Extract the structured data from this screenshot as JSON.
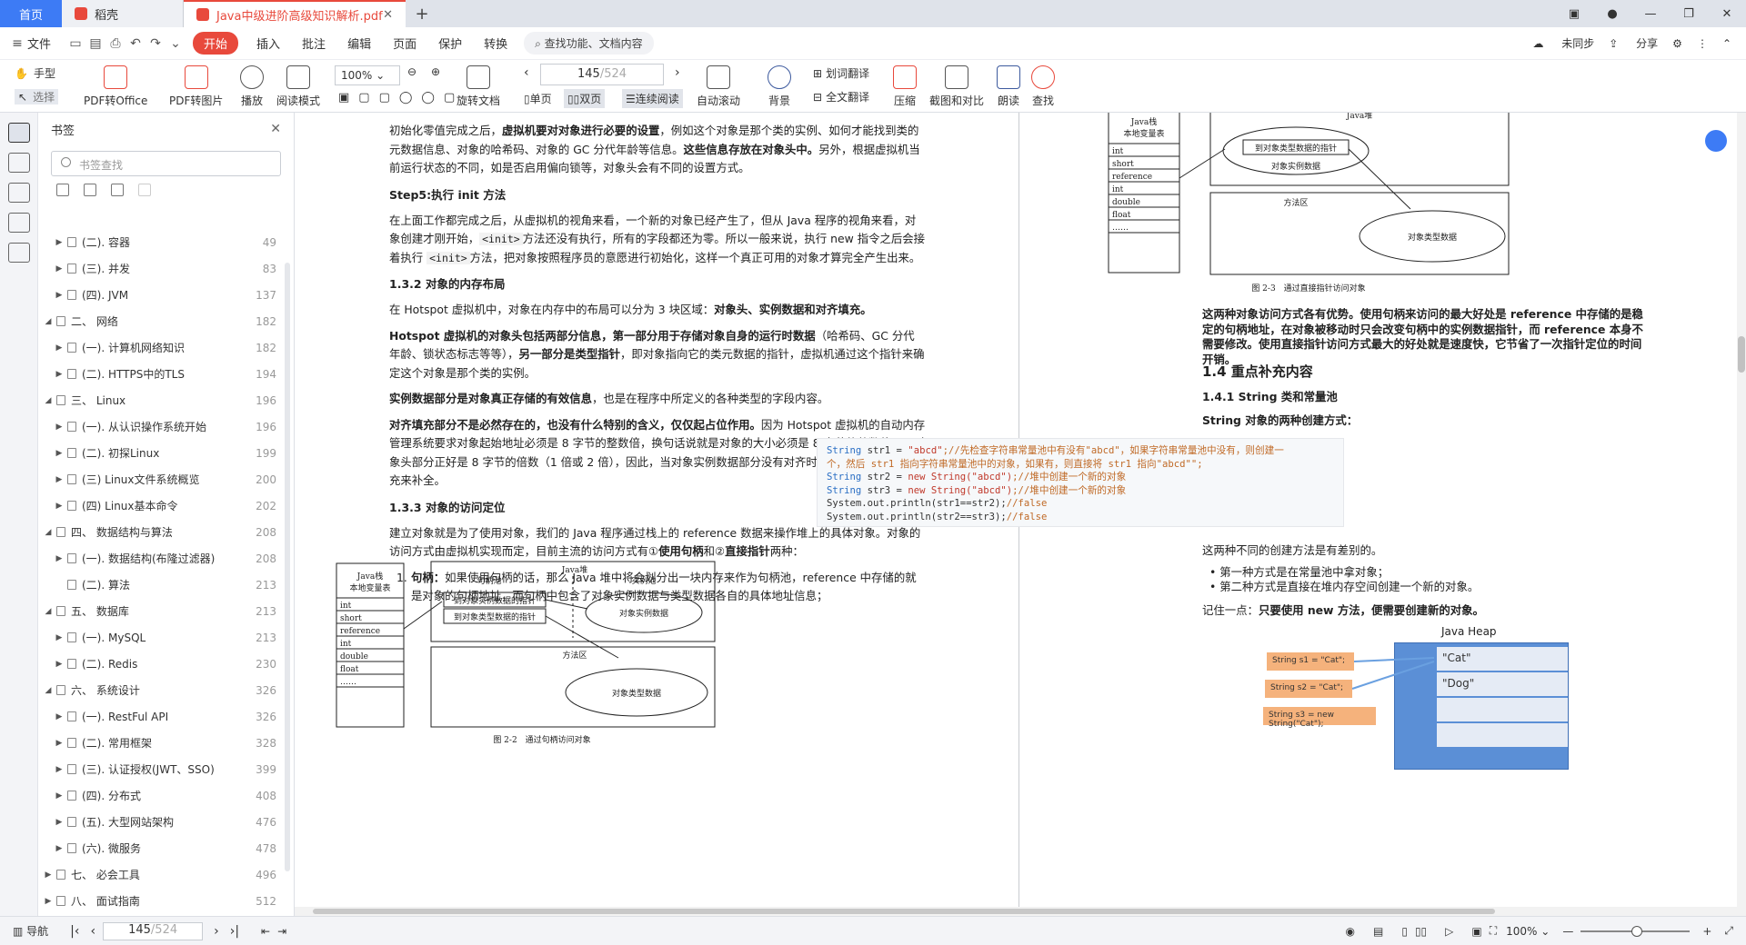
{
  "tabs": {
    "home": "首页",
    "store": "稻壳",
    "doc": "Java中级进阶高级知识解析.pdf"
  },
  "menu": {
    "file": "文件",
    "start": "开始",
    "items": [
      "插入",
      "批注",
      "编辑",
      "页面",
      "保护",
      "转换"
    ],
    "search": "查找功能、文档内容",
    "sync": "未同步",
    "share": "分享"
  },
  "toolbar": {
    "hand": "手型",
    "select": "选择",
    "pdf_office": "PDF转Office",
    "pdf_img": "PDF转图片",
    "play": "播放",
    "read": "阅读模式",
    "zoom": "100%",
    "rotate": "旋转文档",
    "page_current": "145",
    "page_total": "/524",
    "single": "单页",
    "double": "双页",
    "continuous": "连续阅读",
    "autoscroll": "自动滚动",
    "bg": "背景",
    "word_tr": "划词翻译",
    "full_tr": "全文翻译",
    "compress": "压缩",
    "screenshot": "截图和对比",
    "read_aloud": "朗读",
    "find": "查找"
  },
  "bookmark": {
    "title": "书签",
    "search_placeholder": "书签查找",
    "items": [
      {
        "label": "(二). 容器",
        "page": "49",
        "lvl": 1,
        "ar": "▶"
      },
      {
        "label": "(三). 并发",
        "page": "83",
        "lvl": 1,
        "ar": "▶"
      },
      {
        "label": "(四). JVM",
        "page": "137",
        "lvl": 1,
        "ar": "▶"
      },
      {
        "label": "二、 网络",
        "page": "182",
        "lvl": 0,
        "ar": "◢"
      },
      {
        "label": "(一). 计算机网络知识",
        "page": "182",
        "lvl": 1,
        "ar": "▶"
      },
      {
        "label": "(二). HTTPS中的TLS",
        "page": "194",
        "lvl": 1,
        "ar": "▶"
      },
      {
        "label": "三、 Linux",
        "page": "196",
        "lvl": 0,
        "ar": "◢"
      },
      {
        "label": "(一). 从认识操作系统开始",
        "page": "196",
        "lvl": 1,
        "ar": "▶"
      },
      {
        "label": "(二). 初探Linux",
        "page": "199",
        "lvl": 1,
        "ar": "▶"
      },
      {
        "label": "(三) Linux文件系统概览",
        "page": "200",
        "lvl": 1,
        "ar": "▶"
      },
      {
        "label": "(四) Linux基本命令",
        "page": "202",
        "lvl": 1,
        "ar": "▶"
      },
      {
        "label": "四、 数据结构与算法",
        "page": "208",
        "lvl": 0,
        "ar": "◢"
      },
      {
        "label": "(一). 数据结构(布隆过滤器)",
        "page": "208",
        "lvl": 1,
        "ar": "▶"
      },
      {
        "label": "(二). 算法",
        "page": "213",
        "lvl": 1,
        "ar": ""
      },
      {
        "label": "五、 数据库",
        "page": "213",
        "lvl": 0,
        "ar": "◢"
      },
      {
        "label": "(一). MySQL",
        "page": "213",
        "lvl": 1,
        "ar": "▶"
      },
      {
        "label": "(二). Redis",
        "page": "230",
        "lvl": 1,
        "ar": "▶"
      },
      {
        "label": "六、 系统设计",
        "page": "326",
        "lvl": 0,
        "ar": "◢"
      },
      {
        "label": "(一). RestFul API",
        "page": "326",
        "lvl": 1,
        "ar": "▶"
      },
      {
        "label": "(二). 常用框架",
        "page": "328",
        "lvl": 1,
        "ar": "▶"
      },
      {
        "label": "(三). 认证授权(JWT、SSO)",
        "page": "399",
        "lvl": 1,
        "ar": "▶"
      },
      {
        "label": "(四). 分布式",
        "page": "408",
        "lvl": 1,
        "ar": "▶"
      },
      {
        "label": "(五). 大型网站架构",
        "page": "476",
        "lvl": 1,
        "ar": "▶"
      },
      {
        "label": "(六). 微服务",
        "page": "478",
        "lvl": 1,
        "ar": "▶"
      },
      {
        "label": "七、 必会工具",
        "page": "496",
        "lvl": 0,
        "ar": "▶"
      },
      {
        "label": "八、 面试指南",
        "page": "512",
        "lvl": 0,
        "ar": "▶"
      }
    ]
  },
  "left_page": {
    "p1a": "初始化零值完成之后，",
    "p1b": "虚拟机要对对象进行必要的设置",
    "p1c": "，例如这个对象是那个类的实例、如何才能找到类的元数据信息、对象的哈希码、对象的 GC 分代年龄等信息。",
    "p1d": "这些信息存放在对象头中。",
    "p1e": "另外，根据虚拟机当前运行状态的不同，如是否启用偏向锁等，对象头会有不同的设置方式。",
    "h_step5": "Step5:执行 init 方法",
    "p2a": "在上面工作都完成之后，从虚拟机的视角来看，一个新的对象已经产生了，但从 Java 程序的视角来看，对象创建才刚开始，",
    "init": "<init>",
    "p2b": "方法还没有执行，所有的字段都还为零。所以一般来说，执行 new 指令之后会接着执行",
    "p2c": "方法，把对象按照程序员的意愿进行初始化，这样一个真正可用的对象才算完全产生出来。",
    "h_layout": "1.3.2 对象的内存布局",
    "p3a": "在 Hotspot 虚拟机中，对象在内存中的布局可以分为 3 块区域：",
    "p3b": "对象头、实例数据和对齐填充。",
    "p4a": "Hotspot 虚拟机的对象头包括两部分信息，第一部分用于存储对象自身的运行时数据",
    "p4b": "（哈希码、GC 分代年龄、锁状态标志等等），",
    "p4c": "另一部分是类型指针",
    "p4d": "，即对象指向它的类元数据的指针，虚拟机通过这个指针来确定这个对象是那个类的实例。",
    "p5a": "实例数据部分是对象真正存储的有效信息",
    "p5b": "，也是在程序中所定义的各种类型的字段内容。",
    "p6a": "对齐填充部分不是必然存在的，也没有什么特别的含义，仅仅起占位作用。",
    "p6b": "因为 Hotspot 虚拟机的自动内存管理系统要求对象起始地址必须是 8 字节的整数倍，换句话说就是对象的大小必须是 8 字节的整数倍。而对象头部分正好是 8 字节的倍数（1 倍或 2 倍），因此，当对象实例数据部分没有对齐时，就需要通过对齐填充来补全。",
    "h_access": "1.3.3 对象的访问定位",
    "p7a": "建立对象就是为了使用对象，我们的 Java 程序通过栈上的 reference 数据来操作堆上的具体对象。对象的访问方式由虚拟机实现而定，目前主流的访问方式有①",
    "p7b": "使用句柄",
    "p7c": "和②",
    "p7d": "直接指针",
    "p7e": "两种：",
    "li1a": "句柄：",
    "li1b": "如果使用句柄的话，那么 Java 堆中将会划分出一块内存来作为句柄池，reference 中存储的就是对象的句柄地址，而句柄中包含了对象实例数据与类型数据各自的具体地址信息；",
    "fig1": {
      "stack_title1": "Java栈",
      "stack_title2": "本地变量表",
      "rows": [
        "int",
        "short",
        "reference",
        "int",
        "double",
        "float",
        "……"
      ],
      "heap": "Java堆",
      "pool": "句柄池",
      "inst": "实例池",
      "ptr1": "到对象实例数据的指针",
      "ptr2": "到对象类型数据的指针",
      "instdata": "对象实例数据",
      "method": "方法区",
      "typedata": "对象类型数据",
      "caption": "图 2-2　通过句柄访问对象"
    }
  },
  "right_page": {
    "fig2": {
      "stack_title1": "Java栈",
      "stack_title2": "本地变量表",
      "rows": [
        "int",
        "short",
        "reference",
        "int",
        "double",
        "float",
        "……"
      ],
      "heap": "Java堆",
      "ptr": "到对象类型数据的指针",
      "instdata": "对象实例数据",
      "method": "方法区",
      "typedata": "对象类型数据",
      "caption": "图 2-3　通过直接指针访问对象"
    },
    "p1": "这两种对象访问方式各有优势。使用句柄来访问的最大好处是 reference 中存储的是稳定的句柄地址，在对象被移动时只会改变句柄中的实例数据指针，而 reference 本身不需要修改。使用直接指针访问方式最大的好处就是速度快，它节省了一次指针定位的时间开销。",
    "h14": "1.4 重点补充内容",
    "h141": "1.4.1 String 类和常量池",
    "h_two": "String 对象的两种创建方式：",
    "code": [
      {
        "t": "String",
        "a": " str1 = ",
        "s": "\"abcd\"",
        "c": ";//先检查字符串常量池中有没有\"abcd\"，如果字符串常量池中没有，则创建一"
      },
      {
        "t": "",
        "a": "",
        "s": "",
        "c": "个，然后 str1 指向字符串常量池中的对象，如果有，则直接将 str1 指向\"abcd\"\";"
      },
      {
        "t": "String",
        "a": " str2 = ",
        "s": "new String(\"abcd\")",
        "c": ";//堆中创建一个新的对象"
      },
      {
        "t": "String",
        "a": " str3 = ",
        "s": "new String(\"abcd\")",
        "c": ";//堆中创建一个新的对象"
      },
      {
        "t": "",
        "a": "System.out.println(str1==str2);",
        "s": "",
        "c": "//false"
      },
      {
        "t": "",
        "a": "System.out.println(str2==str3);",
        "s": "",
        "c": "//false"
      }
    ],
    "p2": "这两种不同的创建方法是有差别的。",
    "li1": "第一种方式是在常量池中拿对象；",
    "li2": "第二种方式是直接在堆内存空间创建一个新的对象。",
    "p3a": "记住一点：",
    "p3b": "只要使用 new 方法，便需要创建新的对象。",
    "fig3": {
      "title": "Java Heap",
      "s1": "String s1 = \"Cat\";",
      "s2": "String s2 = \"Cat\";",
      "s3": "String s3 = new String(\"Cat\");",
      "cat": "\"Cat\"",
      "dog": "\"Dog\""
    }
  },
  "status": {
    "nav": "导航",
    "page_current": "145",
    "page_total": "/524",
    "zoom": "100%"
  }
}
